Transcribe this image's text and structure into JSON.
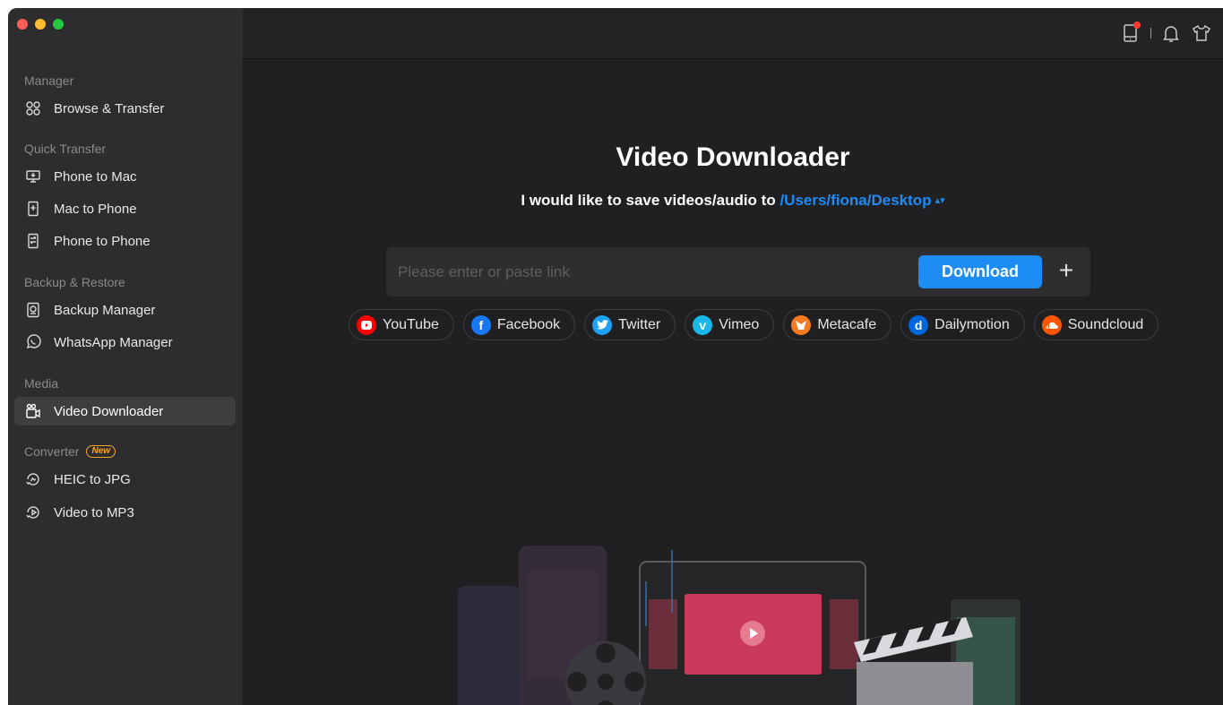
{
  "sidebar": {
    "sections": [
      {
        "title": "Manager"
      },
      {
        "title": "Quick Transfer"
      },
      {
        "title": "Backup & Restore"
      },
      {
        "title": "Media"
      },
      {
        "title": "Converter",
        "badge": "New"
      }
    ],
    "items": [
      {
        "label": "Browse & Transfer",
        "icon": "browse-icon"
      },
      {
        "label": "Phone to Mac",
        "icon": "phone-to-mac-icon"
      },
      {
        "label": "Mac to Phone",
        "icon": "mac-to-phone-icon"
      },
      {
        "label": "Phone to Phone",
        "icon": "phone-to-phone-icon"
      },
      {
        "label": "Backup Manager",
        "icon": "backup-icon"
      },
      {
        "label": "WhatsApp Manager",
        "icon": "whatsapp-icon"
      },
      {
        "label": "Video Downloader",
        "icon": "video-camera-icon",
        "active": true
      },
      {
        "label": "HEIC to JPG",
        "icon": "heic-convert-icon"
      },
      {
        "label": "Video to MP3",
        "icon": "video-convert-icon"
      }
    ]
  },
  "topbar": {
    "icons": [
      "device-icon",
      "bell-icon",
      "shirt-icon"
    ]
  },
  "main": {
    "title": "Video Downloader",
    "save_prefix": "I would like to save videos/audio to",
    "save_path": "/Users/fiona/Desktop",
    "link_placeholder": "Please enter or paste link",
    "link_value": "",
    "download_label": "Download",
    "add_label": "+"
  },
  "sites": [
    {
      "label": "YouTube",
      "color": "#ff0000",
      "icon": "youtube-icon"
    },
    {
      "label": "Facebook",
      "color": "#1877f2",
      "icon": "facebook-icon"
    },
    {
      "label": "Twitter",
      "color": "#1da1f2",
      "icon": "twitter-icon"
    },
    {
      "label": "Vimeo",
      "color": "#1ab7ea",
      "icon": "vimeo-icon"
    },
    {
      "label": "Metacafe",
      "color": "#f47b20",
      "icon": "metacafe-icon"
    },
    {
      "label": "Dailymotion",
      "color": "#0066dc",
      "icon": "dailymotion-icon"
    },
    {
      "label": "Soundcloud",
      "color": "#ff5500",
      "icon": "soundcloud-icon"
    }
  ],
  "colors": {
    "accent": "#1e8cf5",
    "badge": "#f5a623",
    "sidebar_bg": "#2d2d2f",
    "main_bg": "#202022"
  }
}
